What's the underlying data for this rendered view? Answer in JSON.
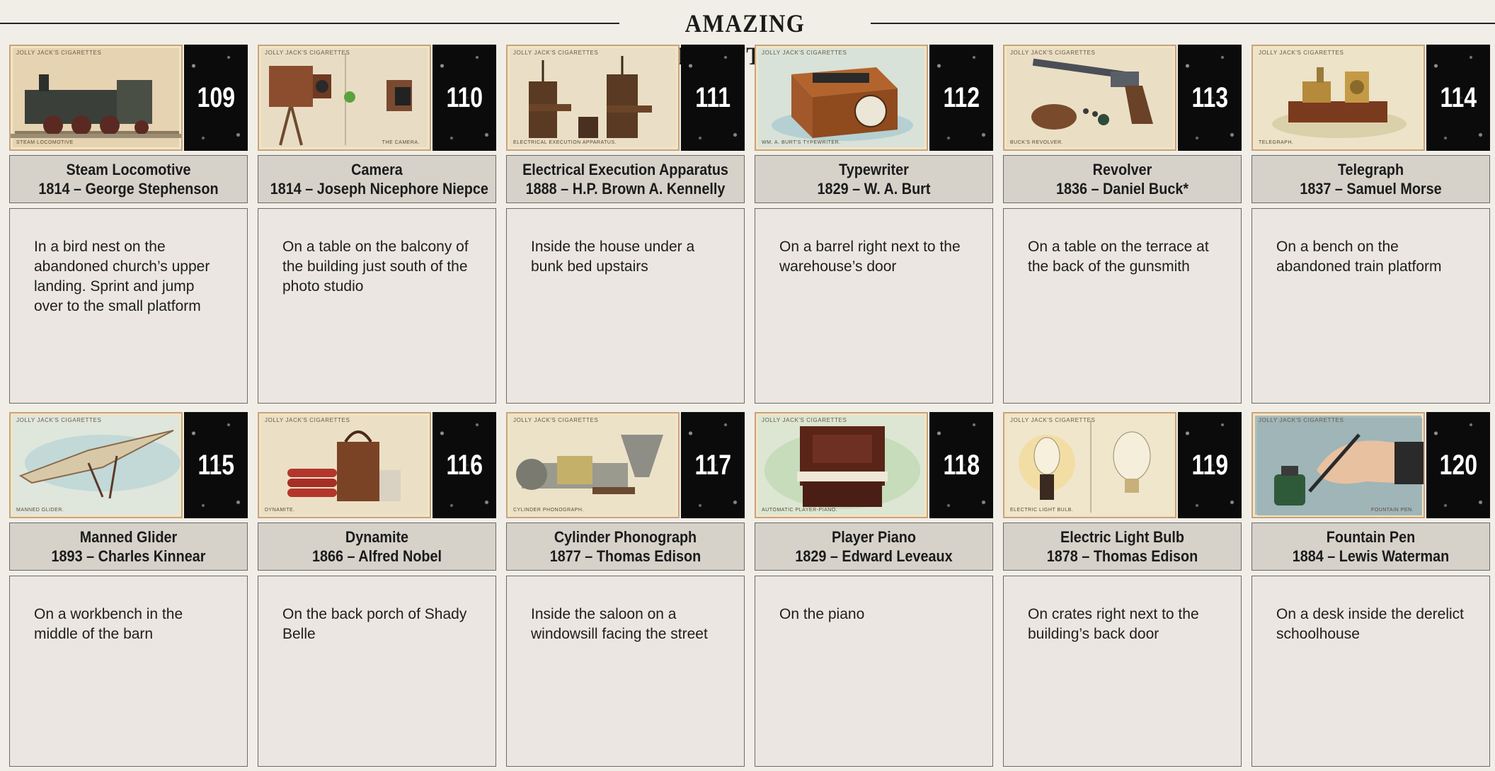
{
  "page": {
    "title": "AMAZING INVENTIONS"
  },
  "cards": [
    {
      "number": "109",
      "brand": "JOLLY JACK'S CIGARETTES",
      "caption": "STEAM LOCOMOTIVE",
      "name": "Steam Locomotive",
      "detail": "1814 – George Stephenson",
      "location": "In a bird nest on the abandoned church’s upper landing. Sprint and jump over to the small platform"
    },
    {
      "number": "110",
      "brand": "JOLLY JACK'S CIGARETTES",
      "caption": "THE CAMERA.",
      "name": "Camera",
      "detail": "1814 – Joseph Nicephore Niepce",
      "location": "On a table on the balcony of the building just south of the photo studio"
    },
    {
      "number": "111",
      "brand": "JOLLY JACK'S CIGARETTES",
      "caption": "ELECTRICAL EXECUTION APPARATUS.",
      "name": "Electrical Execution Apparatus",
      "detail": "1888 – H.P. Brown A. Kennelly",
      "location": "Inside the house under a bunk bed upstairs"
    },
    {
      "number": "112",
      "brand": "JOLLY JACK'S CIGARETTES",
      "caption": "WM. A. BURT'S TYPEWRITER.",
      "name": "Typewriter",
      "detail": "1829 – W. A. Burt",
      "location": "On a barrel right next to the warehouse’s door"
    },
    {
      "number": "113",
      "brand": "JOLLY JACK'S CIGARETTES",
      "caption": "BUCK'S REVOLVER.",
      "name": "Revolver",
      "detail": "1836 – Daniel Buck*",
      "location": "On a table on the terrace at the back of the gunsmith"
    },
    {
      "number": "114",
      "brand": "JOLLY JACK'S CIGARETTES",
      "caption": "TELEGRAPH.",
      "name": "Telegraph",
      "detail": "1837 – Samuel Morse",
      "location": "On a bench on the abandoned train platform"
    },
    {
      "number": "115",
      "brand": "JOLLY JACK'S CIGARETTES",
      "caption": "MANNED GLIDER.",
      "name": "Manned Glider",
      "detail": "1893 – Charles Kinnear",
      "location": "On a workbench in the middle of the barn"
    },
    {
      "number": "116",
      "brand": "JOLLY JACK'S CIGARETTES",
      "caption": "DYNAMITE.",
      "name": "Dynamite",
      "detail": "1866 – Alfred Nobel",
      "location": "On the back porch of Shady Belle"
    },
    {
      "number": "117",
      "brand": "JOLLY JACK'S CIGARETTES",
      "caption": "CYLINDER PHONOGRAPH.",
      "name": "Cylinder Phonograph",
      "detail": "1877 – Thomas Edison",
      "location": "Inside the saloon on a windowsill facing the street"
    },
    {
      "number": "118",
      "brand": "JOLLY JACK'S CIGARETTES",
      "caption": "AUTOMATIC PLAYER-PIANO.",
      "name": "Player Piano",
      "detail": "1829 – Edward Leveaux",
      "location": "On the piano"
    },
    {
      "number": "119",
      "brand": "JOLLY JACK'S CIGARETTES",
      "caption": "ELECTRIC LIGHT BULB.",
      "name": "Electric Light Bulb",
      "detail": "1878 – Thomas Edison",
      "location": "On crates right next to the building’s back door"
    },
    {
      "number": "120",
      "brand": "JOLLY JACK'S CIGARETTES",
      "caption": "FOUNTAIN PEN.",
      "name": "Fountain Pen",
      "detail": "1884 – Lewis Waterman",
      "location": "On a desk inside the derelict schoolhouse"
    }
  ]
}
